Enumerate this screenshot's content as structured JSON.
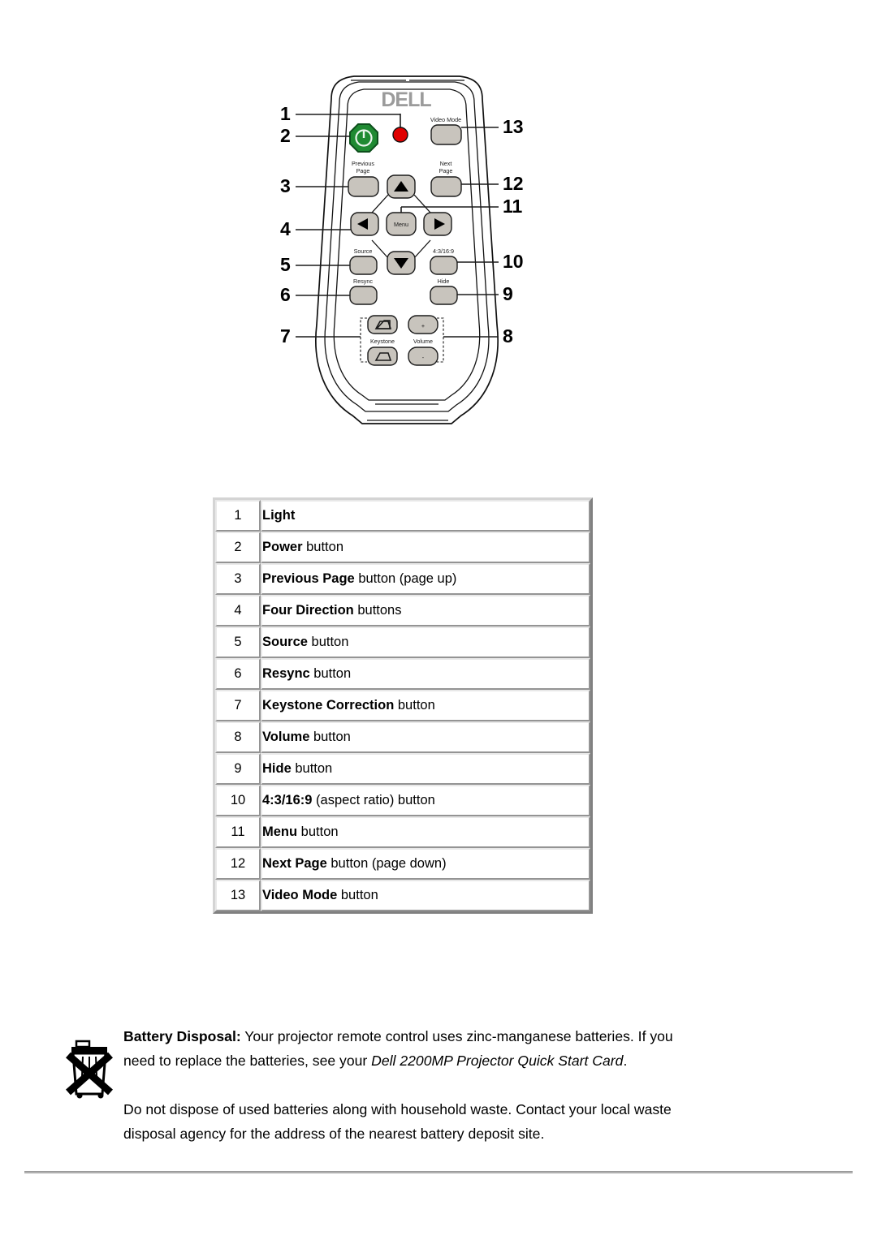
{
  "figure": {
    "name": "Dell 2200MP projector remote control diagram",
    "brand_logo": "DELL",
    "callouts_left": [
      "1",
      "2",
      "3",
      "4",
      "5",
      "6",
      "7"
    ],
    "callouts_right": [
      "13",
      "12",
      "11",
      "10",
      "9",
      "8"
    ],
    "button_labels": {
      "video_mode": "Video Mode",
      "previous_page": "Previous\nPage",
      "previous_page_l1": "Previous",
      "previous_page_l2": "Page",
      "next_page_l1": "Next",
      "next_page_l2": "Page",
      "menu": "Menu",
      "source": "Source",
      "resync": "Resync",
      "aspect": "4:3/16:9",
      "hide": "Hide",
      "keystone": "Keystone",
      "volume": "Volume",
      "volume_plus": "+",
      "volume_minus": "-"
    },
    "colors": {
      "power_button_green": "#1f8a32",
      "indicator_red": "#e00000",
      "button_gray": "#c8c4bd",
      "logo_gray": "#9b9b9b"
    }
  },
  "legend": {
    "rows": [
      {
        "num": "1",
        "bold": "Light",
        "rest": ""
      },
      {
        "num": "2",
        "bold": "Power",
        "rest": " button"
      },
      {
        "num": "3",
        "bold": "Previous Page",
        "rest": " button (page up)"
      },
      {
        "num": "4",
        "bold": "Four Direction",
        "rest": " buttons"
      },
      {
        "num": "5",
        "bold": "Source",
        "rest": " button"
      },
      {
        "num": "6",
        "bold": "Resync",
        "rest": " button"
      },
      {
        "num": "7",
        "bold": "Keystone Correction",
        "rest": " button"
      },
      {
        "num": "8",
        "bold": "Volume",
        "rest": " button"
      },
      {
        "num": "9",
        "bold": "Hide",
        "rest": " button"
      },
      {
        "num": "10",
        "bold": "4:3/16:9",
        "rest": " (aspect ratio) button"
      },
      {
        "num": "11",
        "bold": "Menu",
        "rest": " button"
      },
      {
        "num": "12",
        "bold": "Next Page",
        "rest": " button (page down)"
      },
      {
        "num": "13",
        "bold": "Video Mode",
        "rest": " button"
      }
    ]
  },
  "battery": {
    "icon_name": "crossed-out-wheelie-bin-icon",
    "heading": "Battery Disposal:",
    "para1_a": " Your projector remote control uses zinc-manganese batteries. If you need to replace the batteries, see your ",
    "para1_italic": "Dell 2200MP Projector Quick Start Card",
    "para1_b": ".",
    "para2": "Do not dispose of used batteries along with household waste. Contact your local waste disposal agency for the address of the nearest battery deposit site."
  }
}
